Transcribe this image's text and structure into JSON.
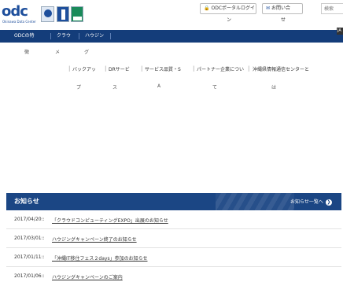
{
  "header": {
    "logo_text": "odc",
    "logo_subtext": "Okinawa Data Center",
    "portal_button": {
      "label": "ODCポータルログイ",
      "wrap": "ン",
      "icon": "lock-icon"
    },
    "contact_button": {
      "label": "お問い合",
      "wrap": "せ",
      "icon": "mail-icon"
    },
    "search_placeholder": "検索",
    "lang_label": "JA"
  },
  "nav": {
    "items": [
      {
        "label": "ODCの特"
      },
      {
        "label": "クラウ"
      },
      {
        "label": "ハウジン"
      }
    ],
    "wrap_chars": [
      "徴",
      "メ",
      "グ"
    ]
  },
  "submenu": {
    "items": [
      {
        "label": "バックアッ"
      },
      {
        "label": "DRサービ"
      },
      {
        "label": "サービス品質・S"
      },
      {
        "label": "パートナー企業につい"
      },
      {
        "label": "沖縄県情報通信センターと"
      }
    ],
    "wrap_chars": [
      "プ",
      "ス",
      "A",
      "て",
      "は"
    ]
  },
  "news": {
    "title": "お知らせ",
    "more_label": "お知らせ一覧へ",
    "more_icon": "arrow-right-icon",
    "items": [
      {
        "date": "2017/04/20::",
        "title": "「クラウドコンピューティングEXPO」出展のお知らせ"
      },
      {
        "date": "2017/03/01::",
        "title": "ハウジングキャンペーン終了のお知らせ"
      },
      {
        "date": "2017/01/11::",
        "title": "「沖縄IT移住フェス２days」参加のお知らせ"
      },
      {
        "date": "2017/01/06::",
        "title": "ハウジングキャンペーンのご案内"
      }
    ]
  },
  "colors": {
    "nav_bg": "#143d7a",
    "news_header_bg": "#1b4684",
    "brand_blue": "#1e4f9c"
  }
}
